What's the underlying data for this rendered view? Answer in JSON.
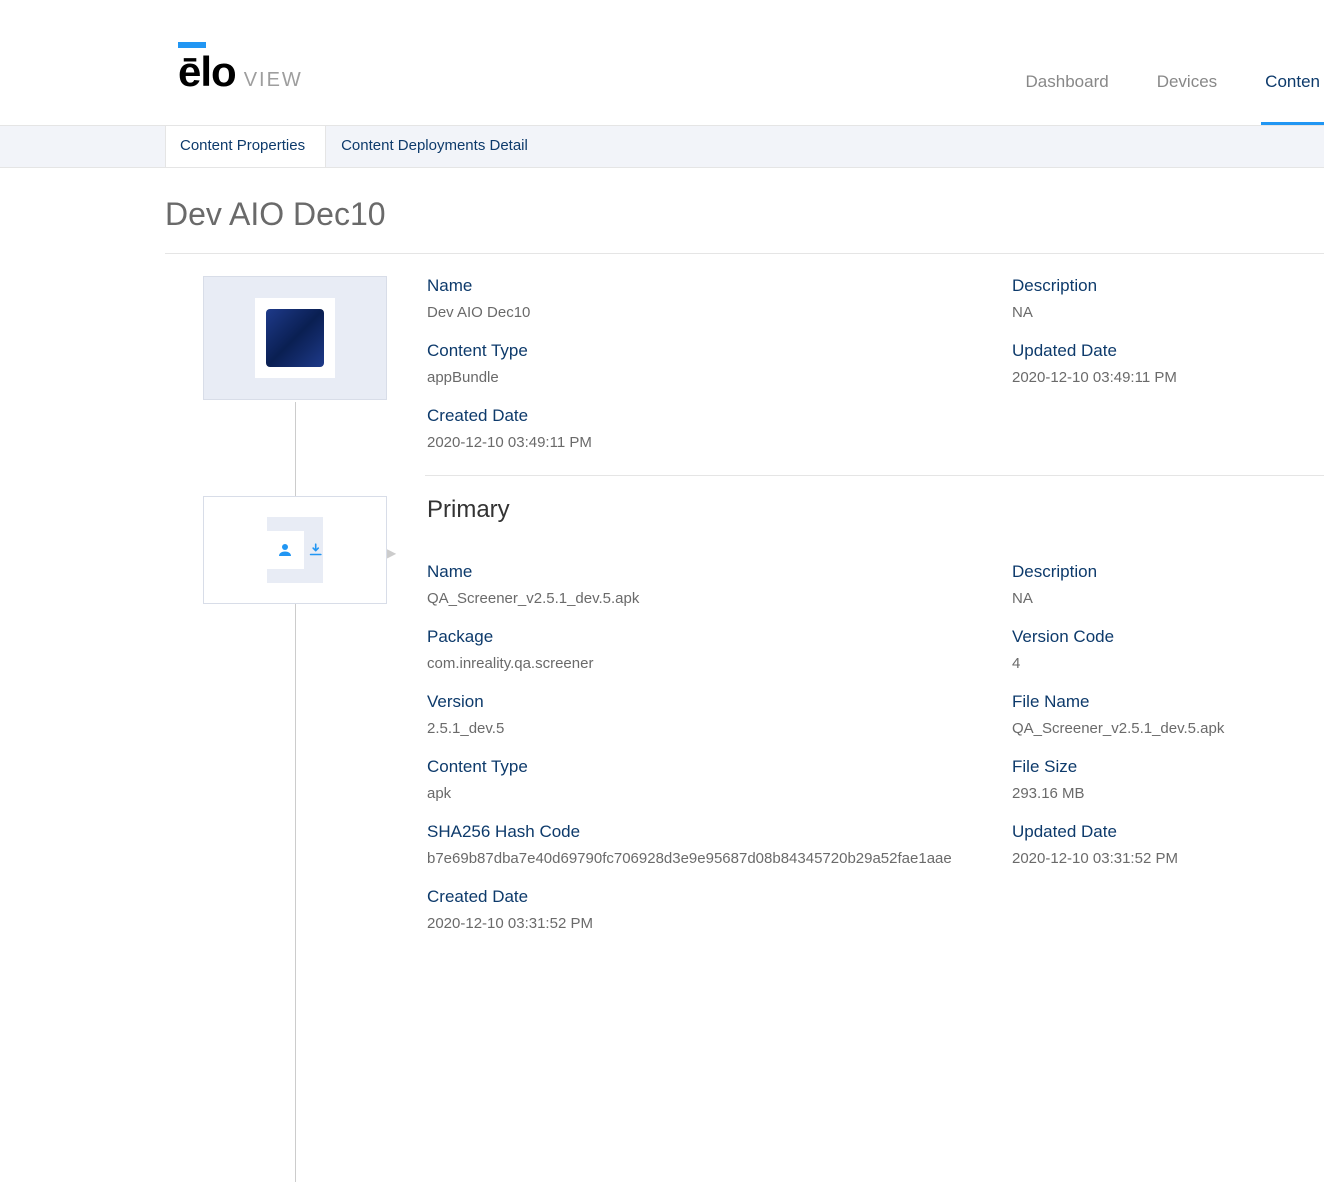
{
  "header": {
    "logo_main": "ēlo",
    "logo_sub": "VIEW",
    "nav": {
      "dashboard": "Dashboard",
      "devices": "Devices",
      "content": "Conten"
    }
  },
  "tabs": {
    "properties": "Content Properties",
    "deployments": "Content Deployments Detail"
  },
  "page_title": "Dev AIO Dec10",
  "bundle": {
    "name_label": "Name",
    "name_value": "Dev AIO Dec10",
    "description_label": "Description",
    "description_value": "NA",
    "content_type_label": "Content Type",
    "content_type_value": "appBundle",
    "updated_label": "Updated Date",
    "updated_value": "2020-12-10 03:49:11 PM",
    "created_label": "Created Date",
    "created_value": "2020-12-10 03:49:11 PM"
  },
  "primary": {
    "title": "Primary",
    "name_label": "Name",
    "name_value": "QA_Screener_v2.5.1_dev.5.apk",
    "description_label": "Description",
    "description_value": "NA",
    "package_label": "Package",
    "package_value": "com.inreality.qa.screener",
    "version_code_label": "Version Code",
    "version_code_value": "4",
    "version_label": "Version",
    "version_value": "2.5.1_dev.5",
    "file_name_label": "File Name",
    "file_name_value": "QA_Screener_v2.5.1_dev.5.apk",
    "content_type_label": "Content Type",
    "content_type_value": "apk",
    "file_size_label": "File Size",
    "file_size_value": "293.16 MB",
    "sha_label": "SHA256 Hash Code",
    "sha_value": "b7e69b87dba7e40d69790fc706928d3e9e95687d08b84345720b29a52fae1aae",
    "updated_label": "Updated Date",
    "updated_value": "2020-12-10 03:31:52 PM",
    "created_label": "Created Date",
    "created_value": "2020-12-10 03:31:52 PM"
  }
}
